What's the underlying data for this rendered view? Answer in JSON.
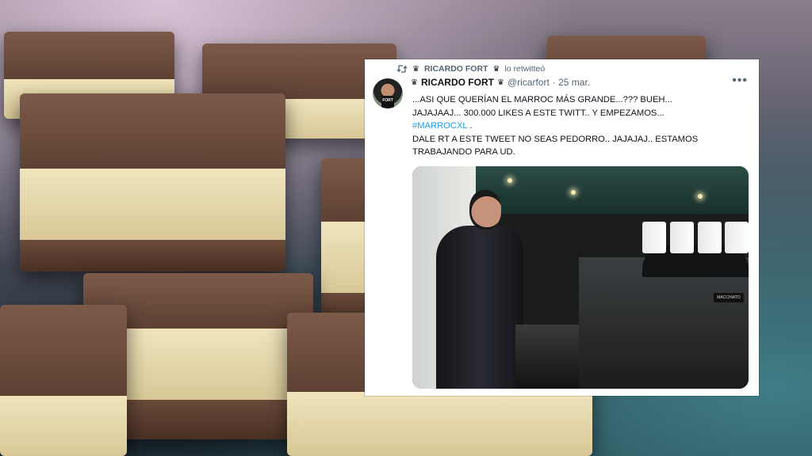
{
  "retweet": {
    "name": "RICARDO FORT",
    "label": "lo retwitteó"
  },
  "author": {
    "name": "RICARDO FORT",
    "handle": "@ricarfort",
    "date": "· 25 mar.",
    "avatar_shirt_text": "FORT"
  },
  "tweet": {
    "line1": "...ASI QUE QUERÍAN EL MARROC MÁS GRANDE...??? BUEH...",
    "line2": "JAJAJAAJ... 300.000 LIKES A ESTE TWITT.. Y EMPEZAMOS...",
    "hashtag": "#MARROCXL",
    "hashtag_suffix": " .",
    "line3": "DALE RT A ESTE TWEET NO SEAS PEDORRO.. JAJAJAJ.. ESTAMOS",
    "line4": "TRABAJANDO PARA UD."
  },
  "media": {
    "brand_text": "MACCHIATO"
  },
  "colors": {
    "hashtag": "#1d9bf0",
    "secondary_text": "#536471",
    "primary_text": "#0f1419"
  },
  "icons": {
    "retweet": "retweet-icon",
    "more": "more-options-icon",
    "crown": "crown-icon"
  }
}
